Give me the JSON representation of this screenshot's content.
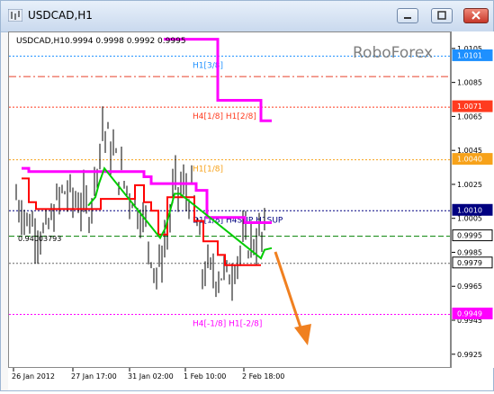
{
  "window": {
    "title": "USDCAD,H1"
  },
  "chart_header": {
    "symbol": "USDCAD,H1",
    "ohlc": "0.9994 0.9998 0.9992 0.9995"
  },
  "watermark": "RoboForex",
  "levels": [
    {
      "value": "1.0101",
      "label": "H1[3/8]",
      "color": "#1e90ff",
      "style": "dotted"
    },
    {
      "value": "1.0089",
      "label": "",
      "color": "#e8412a",
      "style": "dashdot"
    },
    {
      "value": "1.0071",
      "label": "H4[1/8] H1[2/8]",
      "color": "#ff3b1f",
      "style": "dotted"
    },
    {
      "value": "1.0040",
      "label": "H1[1/8]",
      "color": "#f7a21a",
      "style": "dotted"
    },
    {
      "value": "1.0010",
      "label": "D1[1/8] H4SUP H1SUP",
      "color": "#000080",
      "style": "dotted"
    },
    {
      "value": "0.9995",
      "label": "",
      "color": "#008000",
      "style": "dashed"
    },
    {
      "value": "0.9979",
      "label": "",
      "color": "#666666",
      "style": "dotted"
    },
    {
      "value": "0.9949",
      "label": "H4[-1/8] H1[-2/8]",
      "color": "#ff00ff",
      "style": "dotted"
    }
  ],
  "left_marker_label": "0.94003793",
  "price_ticks": [
    "1.0105",
    "1.0085",
    "1.0065",
    "1.0045",
    "1.0025",
    "1.0005",
    "0.9985",
    "0.9965",
    "0.9945",
    "0.9925"
  ],
  "highlighted_prices": [
    {
      "value": "1.0101",
      "bg": "#1e90ff"
    },
    {
      "value": "1.0071",
      "bg": "#ff3b1f"
    },
    {
      "value": "1.0040",
      "bg": "#f7a21a"
    },
    {
      "value": "1.0010",
      "bg": "#000080"
    },
    {
      "value": "0.9995",
      "bg": "#ffffff"
    },
    {
      "value": "0.9979",
      "bg": "#ffffff"
    },
    {
      "value": "0.9949",
      "bg": "#ff00ff"
    }
  ],
  "time_ticks": [
    "26 Jan 2012",
    "27 Jan 17:00",
    "31 Jan 02:00",
    "1 Feb 10:00",
    "2 Feb 18:00"
  ],
  "chart_data": {
    "type": "line",
    "title": "",
    "ylim": [
      0.9918,
      1.0115
    ],
    "series": [
      {
        "name": "",
        "color": "#ff00ff",
        "points": [
          [
            14,
            1.0035
          ],
          [
            22,
            1.0035
          ],
          [
            22,
            1.0033
          ],
          [
            150,
            1.0033
          ],
          [
            150,
            1.003
          ],
          [
            158,
            1.003
          ],
          [
            158,
            1.0026
          ],
          [
            208,
            1.0026
          ],
          [
            208,
            1.0022
          ],
          [
            220,
            1.0022
          ],
          [
            220,
            1.0006
          ],
          [
            262,
            1.0006
          ],
          [
            262,
            1.0003
          ],
          [
            292,
            1.0003
          ]
        ]
      },
      {
        "name": "",
        "color": "#ff00ff",
        "points": [
          [
            172,
            1.0111
          ],
          [
            232,
            1.0111
          ],
          [
            232,
            1.0075
          ],
          [
            280,
            1.0075
          ],
          [
            280,
            1.0063
          ],
          [
            292,
            1.0063
          ]
        ]
      },
      {
        "name": "",
        "color": "#ff0000",
        "points": [
          [
            14,
            1.0029
          ],
          [
            22,
            1.0029
          ],
          [
            22,
            1.0015
          ],
          [
            30,
            1.0015
          ],
          [
            30,
            1.0011
          ],
          [
            102,
            1.0011
          ],
          [
            102,
            1.0017
          ],
          [
            140,
            1.0017
          ],
          [
            140,
            1.0025
          ],
          [
            150,
            1.0025
          ],
          [
            150,
            1.0015
          ],
          [
            158,
            1.0015
          ],
          [
            158,
            1.001
          ],
          [
            166,
            1.001
          ],
          [
            166,
            0.9996
          ],
          [
            176,
            0.9996
          ],
          [
            176,
            1.0018
          ],
          [
            206,
            1.0018
          ],
          [
            206,
            1.0004
          ],
          [
            216,
            1.0004
          ],
          [
            216,
            0.9992
          ],
          [
            232,
            0.9992
          ],
          [
            232,
            0.9984
          ],
          [
            240,
            0.9984
          ],
          [
            240,
            0.9978
          ],
          [
            280,
            0.9978
          ]
        ]
      },
      {
        "name": "",
        "color": "#00cc00",
        "points": [
          [
            88,
            1.0013
          ],
          [
            96,
            1.0018
          ],
          [
            100,
            1.0026
          ],
          [
            104,
            1.0032
          ],
          [
            106,
            1.0035
          ],
          [
            168,
            0.9994
          ],
          [
            174,
            1.0
          ],
          [
            178,
            1.0008
          ],
          [
            184,
            1.002
          ],
          [
            190,
            1.002
          ],
          [
            280,
            0.9982
          ],
          [
            284,
            0.9987
          ],
          [
            292,
            0.9988
          ]
        ]
      }
    ]
  }
}
